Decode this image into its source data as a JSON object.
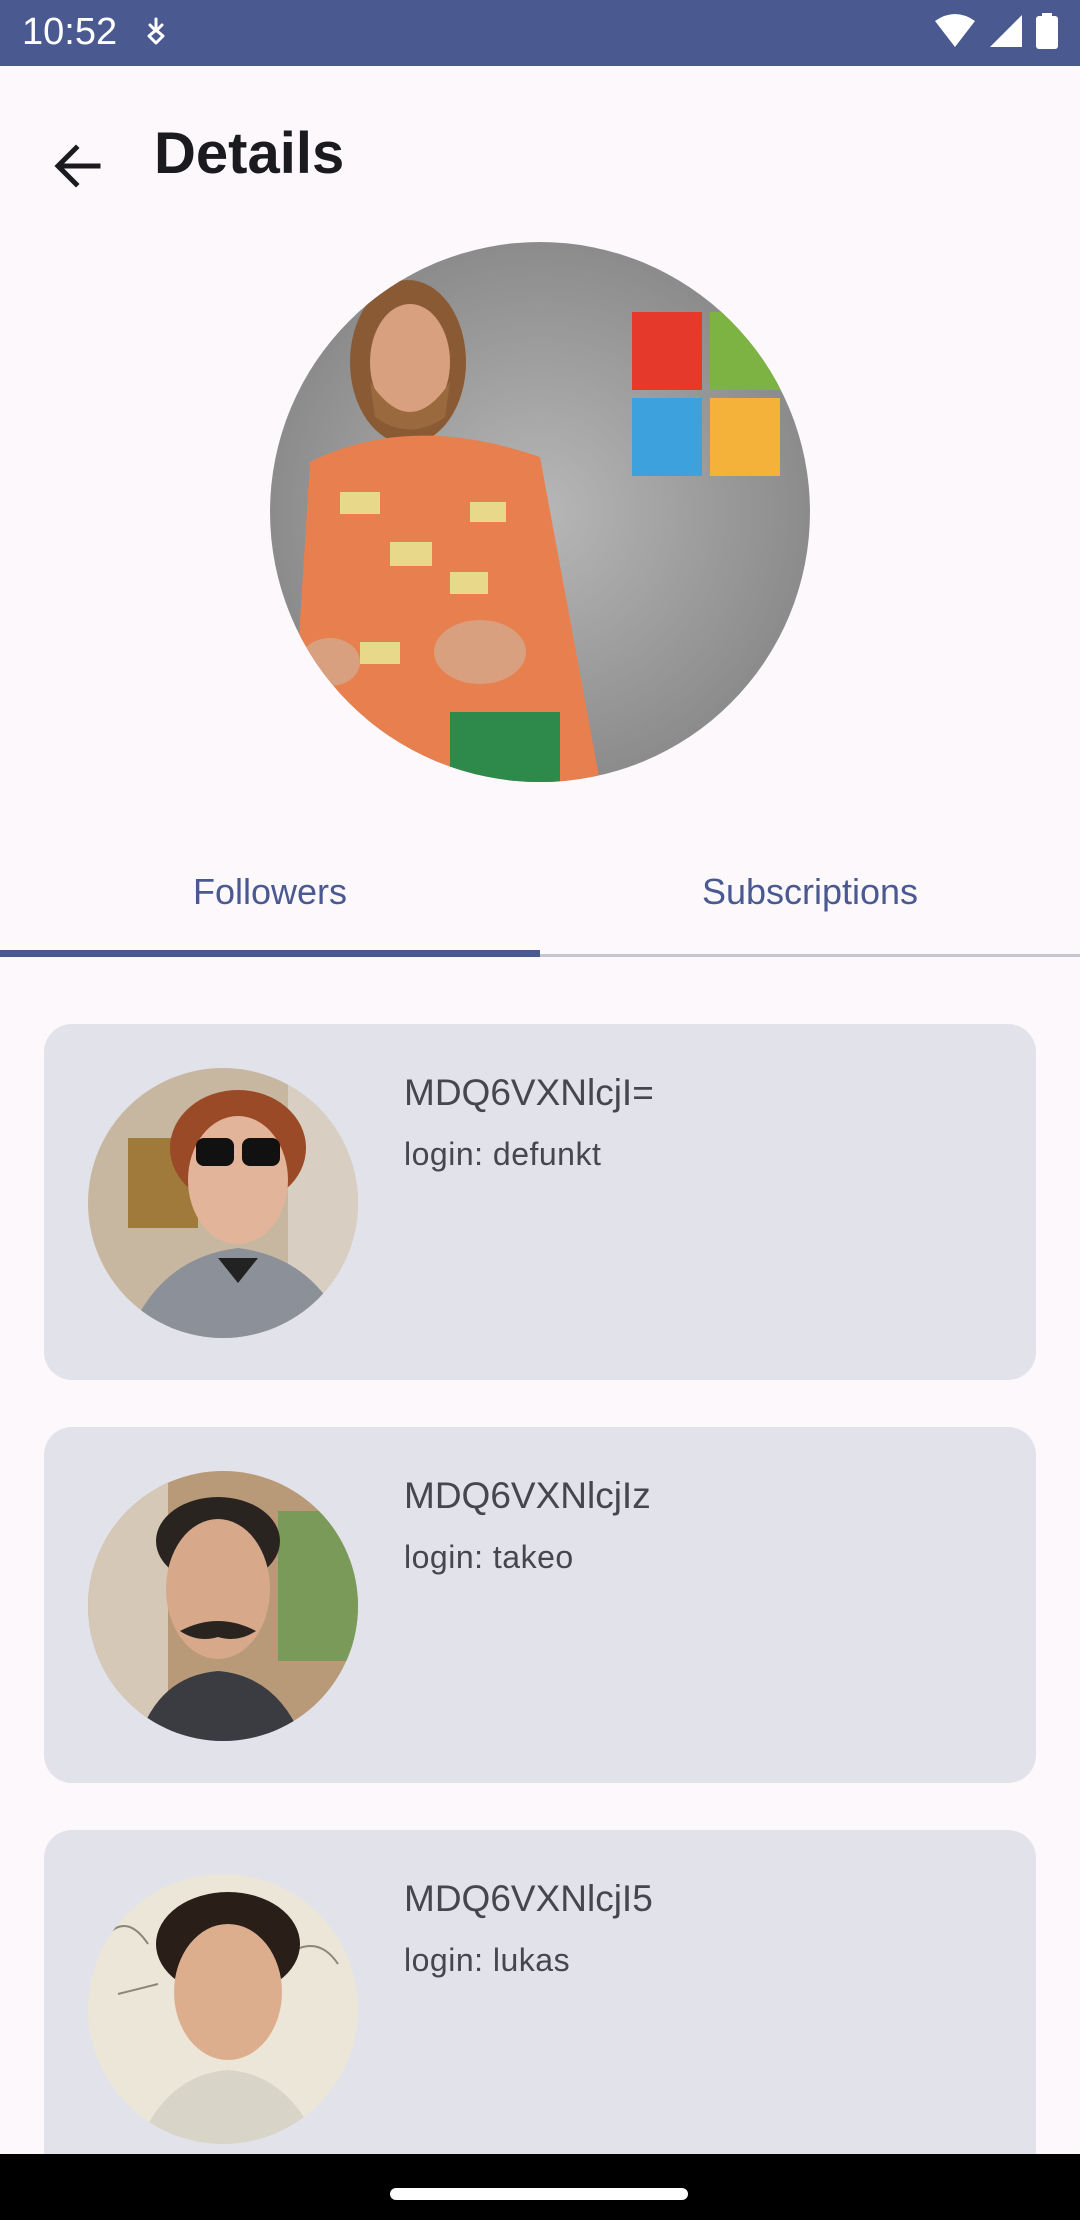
{
  "status_bar": {
    "time": "10:52",
    "background_color": "#4a5a91",
    "icons": [
      "notification-icon",
      "wifi-icon",
      "signal-icon",
      "battery-icon"
    ]
  },
  "app_bar": {
    "title": "Details",
    "back_icon": "arrow-back-icon"
  },
  "profile": {
    "avatar": "profile-photo"
  },
  "tabs": [
    {
      "label": "Followers",
      "selected": true
    },
    {
      "label": "Subscriptions",
      "selected": false
    }
  ],
  "followers": [
    {
      "name": "MDQ6VXNlcjI=",
      "login": "login: defunkt"
    },
    {
      "name": "MDQ6VXNlcjIz",
      "login": "login: takeo"
    },
    {
      "name": "MDQ6VXNlcjI5",
      "login": "login: lukas"
    }
  ],
  "colors": {
    "accent": "#4a5a91",
    "card_background": "#e2e2ea",
    "page_background": "#fcf8fc"
  }
}
